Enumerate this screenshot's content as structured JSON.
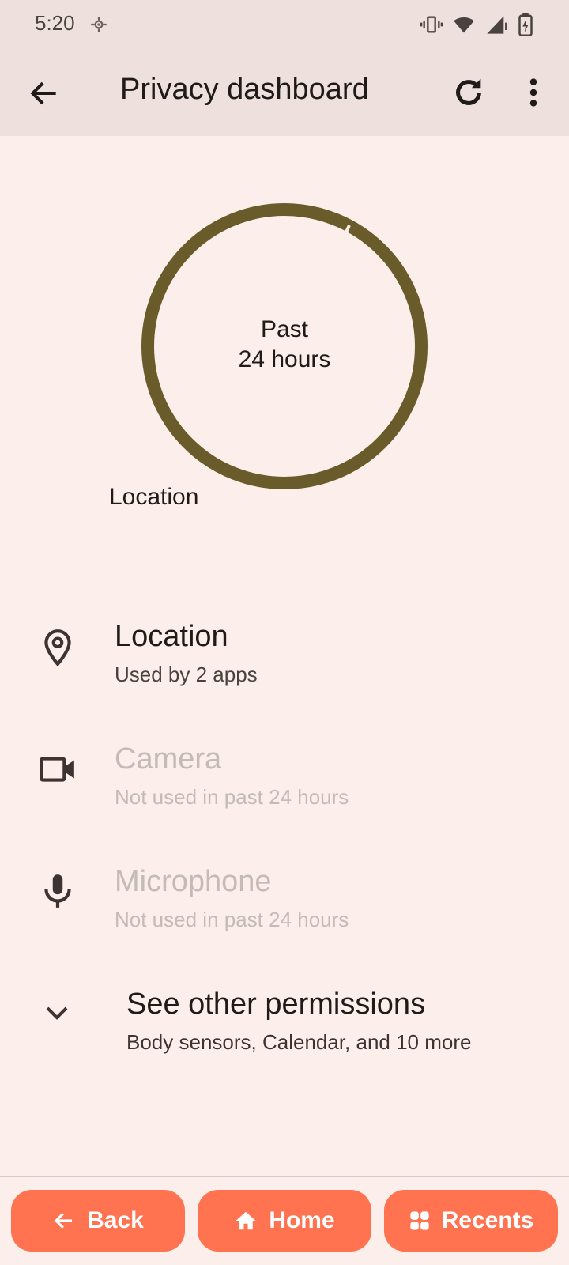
{
  "status_bar": {
    "time": "5:20",
    "icons": [
      "location-icon",
      "vibrate-icon",
      "wifi-icon",
      "signal-icon",
      "battery-charging-icon"
    ]
  },
  "app_bar": {
    "title": "Privacy dashboard",
    "actions": [
      "refresh-icon",
      "more-vert-icon"
    ]
  },
  "usage_chart": {
    "center_text_line1": "Past",
    "center_text_line2": "24 hours",
    "segment_label": "Location",
    "ring_color": "#695c2a"
  },
  "permissions": [
    {
      "title": "Location",
      "subtitle": "Used by 2 apps",
      "icon": "location-pin-icon",
      "enabled": true
    },
    {
      "title": "Camera",
      "subtitle": "Not used in past 24 hours",
      "icon": "camera-icon",
      "enabled": false
    },
    {
      "title": "Microphone",
      "subtitle": "Not used in past 24 hours",
      "icon": "microphone-icon",
      "enabled": false
    }
  ],
  "other_permissions": {
    "title": "See other permissions",
    "subtitle": "Body sensors, Calendar, and 10 more",
    "icon": "chevron-down-icon"
  },
  "nav_bar": {
    "back": "Back",
    "home": "Home",
    "recents": "Recents",
    "button_color": "#ff7350"
  }
}
